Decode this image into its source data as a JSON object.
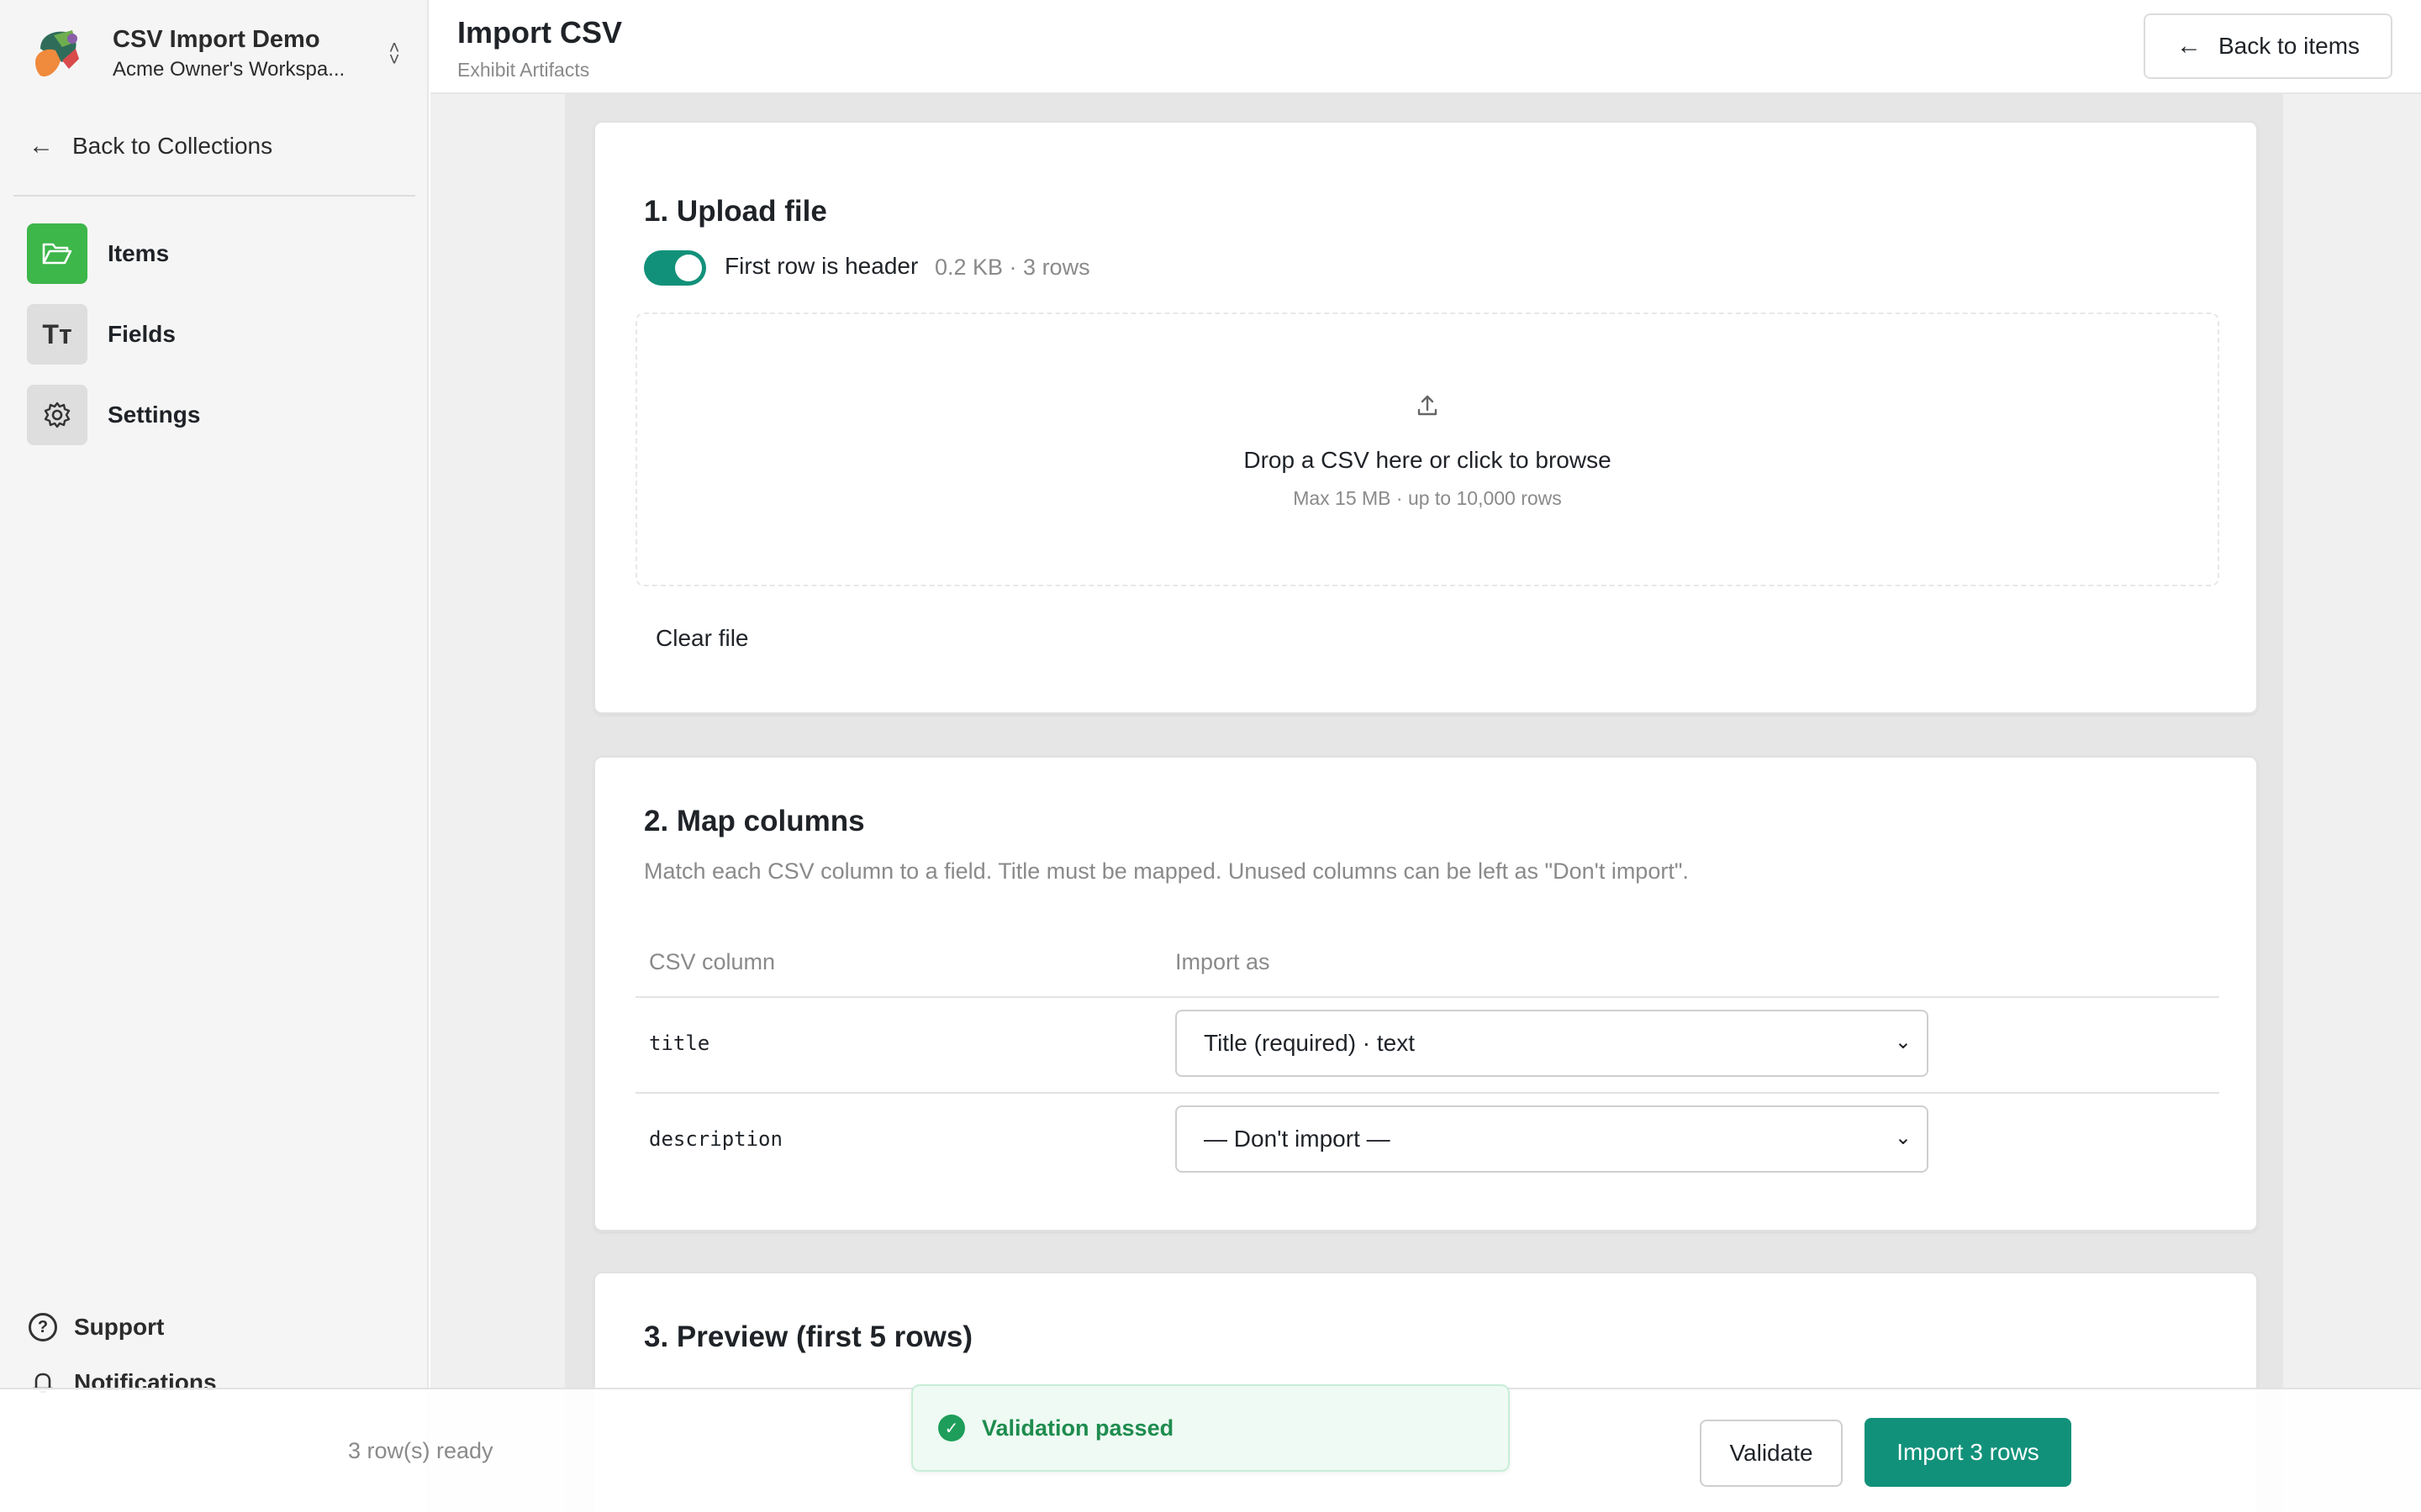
{
  "workspace": {
    "name": "CSV Import Demo",
    "subtitle": "Acme Owner's Workspa...",
    "chevron_icon": "chevron-up-down-icon"
  },
  "sidebar": {
    "back_label": "Back to Collections",
    "items": [
      {
        "label": "Items",
        "icon": "folder-icon",
        "active": true
      },
      {
        "label": "Fields",
        "icon": "text-type-icon",
        "glyph": "Tт",
        "active": false
      },
      {
        "label": "Settings",
        "icon": "gear-icon",
        "active": false
      }
    ],
    "bottom": [
      {
        "label": "Support",
        "icon": "help-circle-icon",
        "glyph": "?"
      },
      {
        "label": "Notifications",
        "icon": "bell-icon"
      }
    ]
  },
  "header": {
    "title": "Import CSV",
    "subtitle": "Exhibit Artifacts",
    "back_items_label": "Back to items"
  },
  "upload": {
    "title": "1. Upload file",
    "toggle_label": "First row is header",
    "toggle_on": true,
    "file_meta": "0.2 KB · 3 rows",
    "drop_text": "Drop a CSV here or click to browse",
    "drop_hint": "Max 15 MB · up to 10,000 rows",
    "clear_label": "Clear file"
  },
  "mapping": {
    "title": "2. Map columns",
    "description": "Match each CSV column to a field. Title must be mapped. Unused columns can be left as \"Don't import\".",
    "headers": [
      "CSV column",
      "Import as"
    ],
    "rows": [
      {
        "column": "title",
        "import_as": "Title (required) · text"
      },
      {
        "column": "description",
        "import_as": "— Don't import —"
      }
    ]
  },
  "preview": {
    "title": "3. Preview (first 5 rows)"
  },
  "footer": {
    "ready_text": "3 row(s) ready",
    "validate_label": "Validate",
    "import_label": "Import 3 rows"
  },
  "toast": {
    "message": "Validation passed"
  },
  "colors": {
    "accent": "#12917a",
    "active_nav": "#3db64a",
    "success": "#1e9e5a"
  }
}
